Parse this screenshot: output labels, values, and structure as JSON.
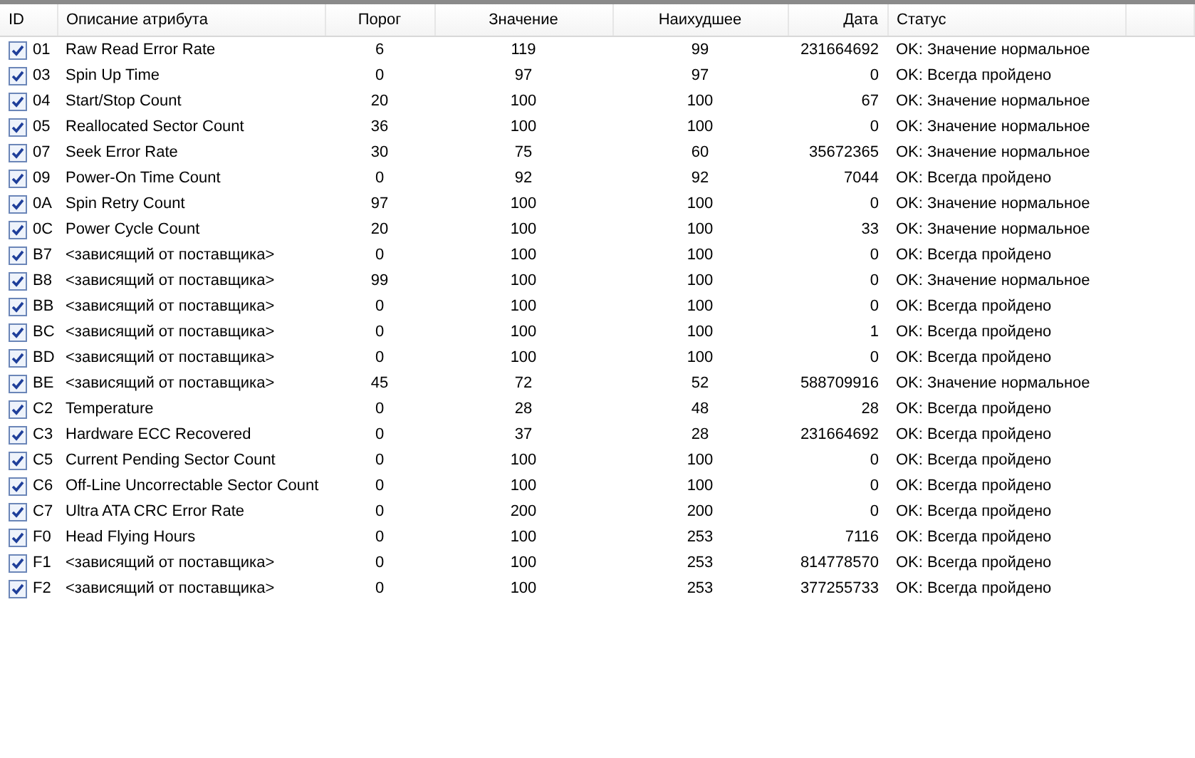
{
  "table": {
    "columns": [
      "ID",
      "Описание атрибута",
      "Порог",
      "Значение",
      "Наихудшее",
      "Дата",
      "Статус"
    ],
    "rows": [
      {
        "checked": true,
        "id": "01",
        "name": "Raw Read Error Rate",
        "threshold": "6",
        "value": "119",
        "worst": "99",
        "data": "231664692",
        "status": "OK: Значение нормальное"
      },
      {
        "checked": true,
        "id": "03",
        "name": "Spin Up Time",
        "threshold": "0",
        "value": "97",
        "worst": "97",
        "data": "0",
        "status": "OK: Всегда пройдено"
      },
      {
        "checked": true,
        "id": "04",
        "name": "Start/Stop Count",
        "threshold": "20",
        "value": "100",
        "worst": "100",
        "data": "67",
        "status": "OK: Значение нормальное"
      },
      {
        "checked": true,
        "id": "05",
        "name": "Reallocated Sector Count",
        "threshold": "36",
        "value": "100",
        "worst": "100",
        "data": "0",
        "status": "OK: Значение нормальное"
      },
      {
        "checked": true,
        "id": "07",
        "name": "Seek Error Rate",
        "threshold": "30",
        "value": "75",
        "worst": "60",
        "data": "35672365",
        "status": "OK: Значение нормальное"
      },
      {
        "checked": true,
        "id": "09",
        "name": "Power-On Time Count",
        "threshold": "0",
        "value": "92",
        "worst": "92",
        "data": "7044",
        "status": "OK: Всегда пройдено"
      },
      {
        "checked": true,
        "id": "0A",
        "name": "Spin Retry Count",
        "threshold": "97",
        "value": "100",
        "worst": "100",
        "data": "0",
        "status": "OK: Значение нормальное"
      },
      {
        "checked": true,
        "id": "0C",
        "name": "Power Cycle Count",
        "threshold": "20",
        "value": "100",
        "worst": "100",
        "data": "33",
        "status": "OK: Значение нормальное"
      },
      {
        "checked": true,
        "id": "B7",
        "name": "<зависящий от поставщика>",
        "threshold": "0",
        "value": "100",
        "worst": "100",
        "data": "0",
        "status": "OK: Всегда пройдено"
      },
      {
        "checked": true,
        "id": "B8",
        "name": "<зависящий от поставщика>",
        "threshold": "99",
        "value": "100",
        "worst": "100",
        "data": "0",
        "status": "OK: Значение нормальное"
      },
      {
        "checked": true,
        "id": "BB",
        "name": "<зависящий от поставщика>",
        "threshold": "0",
        "value": "100",
        "worst": "100",
        "data": "0",
        "status": "OK: Всегда пройдено"
      },
      {
        "checked": true,
        "id": "BC",
        "name": "<зависящий от поставщика>",
        "threshold": "0",
        "value": "100",
        "worst": "100",
        "data": "1",
        "status": "OK: Всегда пройдено"
      },
      {
        "checked": true,
        "id": "BD",
        "name": "<зависящий от поставщика>",
        "threshold": "0",
        "value": "100",
        "worst": "100",
        "data": "0",
        "status": "OK: Всегда пройдено"
      },
      {
        "checked": true,
        "id": "BE",
        "name": "<зависящий от поставщика>",
        "threshold": "45",
        "value": "72",
        "worst": "52",
        "data": "588709916",
        "status": "OK: Значение нормальное"
      },
      {
        "checked": true,
        "id": "C2",
        "name": "Temperature",
        "threshold": "0",
        "value": "28",
        "worst": "48",
        "data": "28",
        "status": "OK: Всегда пройдено"
      },
      {
        "checked": true,
        "id": "C3",
        "name": "Hardware ECC Recovered",
        "threshold": "0",
        "value": "37",
        "worst": "28",
        "data": "231664692",
        "status": "OK: Всегда пройдено"
      },
      {
        "checked": true,
        "id": "C5",
        "name": "Current Pending Sector Count",
        "threshold": "0",
        "value": "100",
        "worst": "100",
        "data": "0",
        "status": "OK: Всегда пройдено"
      },
      {
        "checked": true,
        "id": "C6",
        "name": "Off-Line Uncorrectable Sector Count",
        "threshold": "0",
        "value": "100",
        "worst": "100",
        "data": "0",
        "status": "OK: Всегда пройдено"
      },
      {
        "checked": true,
        "id": "C7",
        "name": "Ultra ATA CRC Error Rate",
        "threshold": "0",
        "value": "200",
        "worst": "200",
        "data": "0",
        "status": "OK: Всегда пройдено"
      },
      {
        "checked": true,
        "id": "F0",
        "name": "Head Flying Hours",
        "threshold": "0",
        "value": "100",
        "worst": "253",
        "data": "7116",
        "status": "OK: Всегда пройдено"
      },
      {
        "checked": true,
        "id": "F1",
        "name": "<зависящий от поставщика>",
        "threshold": "0",
        "value": "100",
        "worst": "253",
        "data": "814778570",
        "status": "OK: Всегда пройдено"
      },
      {
        "checked": true,
        "id": "F2",
        "name": "<зависящий от поставщика>",
        "threshold": "0",
        "value": "100",
        "worst": "253",
        "data": "377255733",
        "status": "OK: Всегда пройдено"
      }
    ]
  }
}
